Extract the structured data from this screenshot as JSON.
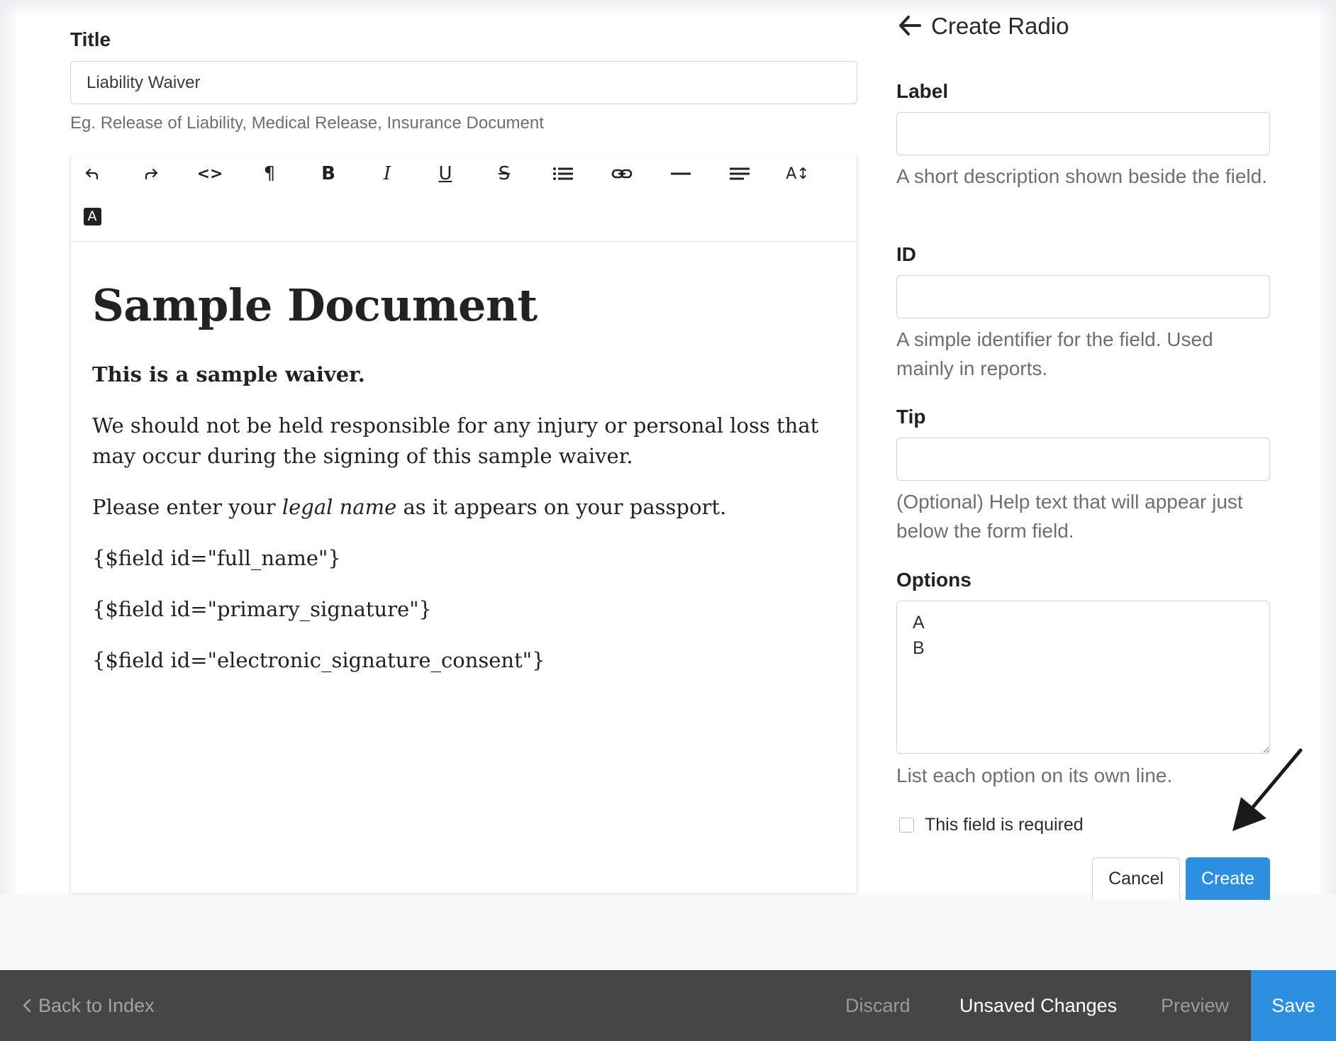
{
  "form": {
    "title_label": "Title",
    "title_value": "Liability Waiver",
    "title_help": "Eg. Release of Liability, Medical Release, Insurance Document"
  },
  "toolbar": {
    "buttons": [
      {
        "icon": "undo-icon"
      },
      {
        "icon": "redo-icon"
      },
      {
        "icon": "code-icon",
        "text": "<>"
      },
      {
        "icon": "paragraph-icon",
        "text": "¶"
      },
      {
        "icon": "bold-icon",
        "text": "B"
      },
      {
        "icon": "italic-icon",
        "text": "I"
      },
      {
        "icon": "underline-icon",
        "text": "U"
      },
      {
        "icon": "strikethrough-icon",
        "text": "S"
      },
      {
        "icon": "bullet-list-icon"
      },
      {
        "icon": "link-icon"
      },
      {
        "icon": "horizontal-rule-icon"
      },
      {
        "icon": "align-icon"
      },
      {
        "icon": "font-size-icon",
        "text": "A↕"
      },
      {
        "icon": "text-color-icon",
        "text": "A"
      }
    ]
  },
  "document": {
    "heading": "Sample Document",
    "intro_bold": "This is a sample waiver.",
    "paragraph1": "We should not be held responsible for any injury or personal loss that may occur during the signing of this sample waiver.",
    "paragraph2_before": "Please enter your ",
    "paragraph2_italic": "legal name",
    "paragraph2_after": " as it appears on your passport.",
    "field1": "{$field id=\"full_name\"}",
    "field2": "{$field id=\"primary_signature\"}",
    "field3": "{$field id=\"electronic_signature_consent\"}"
  },
  "panel": {
    "back_icon": "arrow-left-icon",
    "title": "Create Radio",
    "label_label": "Label",
    "label_value": "",
    "label_help": "A short description shown beside the field.",
    "id_label": "ID",
    "id_value": "",
    "id_help": "A simple identifier for the field. Used mainly in reports.",
    "tip_label": "Tip",
    "tip_value": "",
    "tip_help": "(Optional) Help text that will appear just below the form field.",
    "options_label": "Options",
    "options_value": "A\nB",
    "options_help": "List each option on its own line.",
    "required_label": "This field is required",
    "required_checked": false,
    "cancel_label": "Cancel",
    "create_label": "Create",
    "accent_color": "#2d8fe0"
  },
  "bottom_bar": {
    "back_label": "Back to Index",
    "discard_label": "Discard",
    "unsaved_label": "Unsaved Changes",
    "preview_label": "Preview",
    "save_label": "Save",
    "background_color": "#464646"
  }
}
